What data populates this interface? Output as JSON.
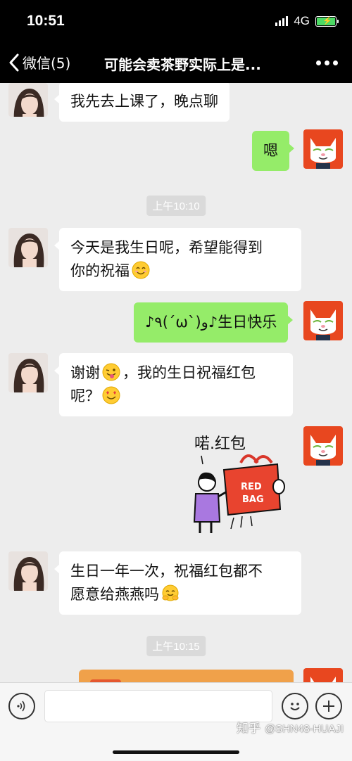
{
  "status": {
    "time": "10:51",
    "network": "4G"
  },
  "nav": {
    "back_label": "微信(5)",
    "title": "可能会卖茶野实际上是..."
  },
  "messages": {
    "m1": {
      "text": "我先去上课了，晚点聊"
    },
    "m2": {
      "text": "嗯"
    },
    "t1": "上午10:10",
    "m3": {
      "line1": "今天是我生日呢，希望能得到",
      "line2": "你的祝福"
    },
    "m4": {
      "text": "♪٩(´ω`)و♪生日快乐"
    },
    "m5": {
      "line1_a": "谢谢",
      "line1_b": "，我的生日祝福红包",
      "line2": "呢？"
    },
    "sticker": {
      "caption": "喏.红包",
      "bag_text_1": "RED",
      "bag_text_2": "BAG"
    },
    "m6": {
      "line1": "生日一年一次，祝福红包都不",
      "line2": "愿意给燕燕吗"
    },
    "t2": "上午10:15"
  },
  "input": {
    "placeholder": ""
  },
  "watermark": {
    "site": "知乎",
    "handle": "@SHN48-HUAJI"
  },
  "colors": {
    "sent_bubble": "#95ec69",
    "received_bubble": "#ffffff",
    "background": "#ededed",
    "redpacket": "#f0a14a"
  },
  "icons": {
    "back": "chevron-left-icon",
    "more": "more-dots-icon",
    "voice": "voice-icon",
    "emoji": "emoji-icon",
    "plus": "plus-icon"
  }
}
